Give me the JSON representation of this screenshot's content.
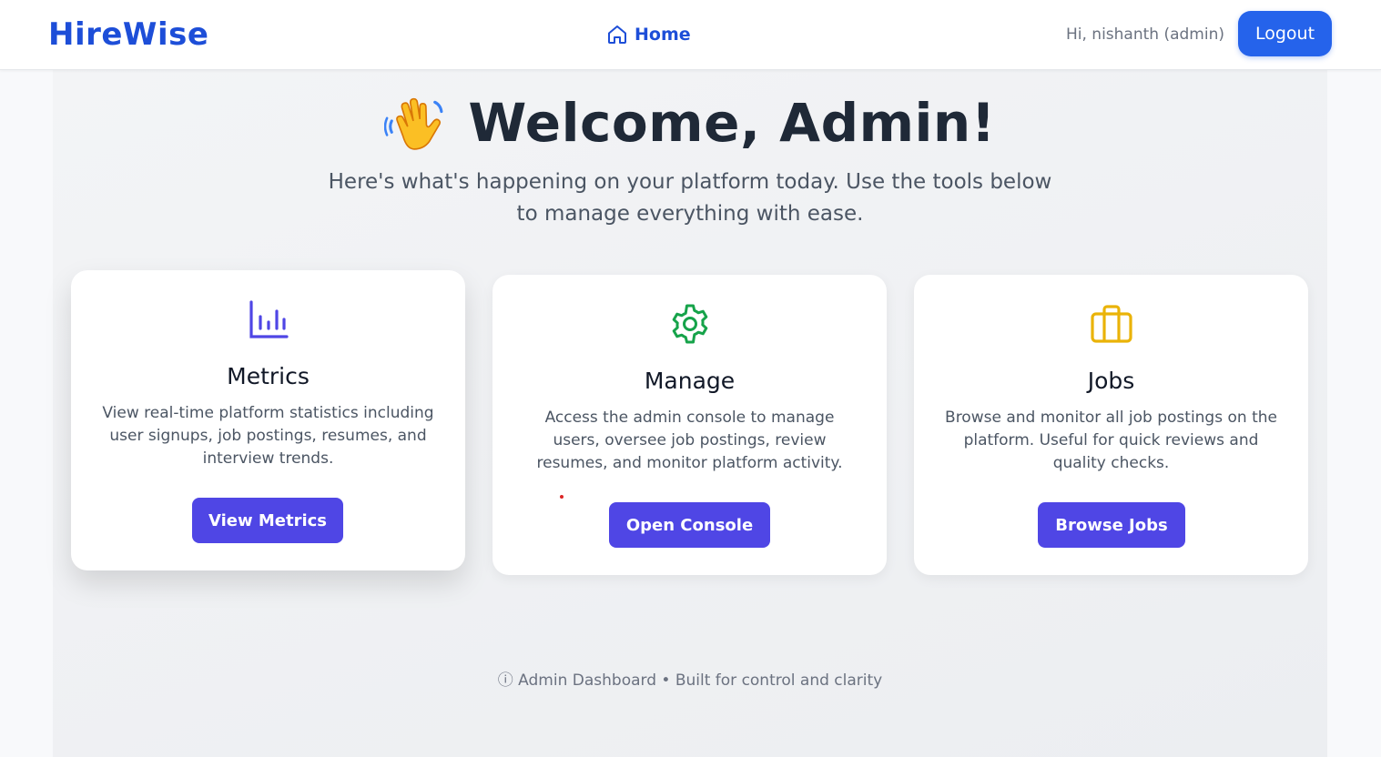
{
  "header": {
    "brand": "HireWise",
    "nav_home": "Home",
    "greeting": "Hi, nishanth (admin)",
    "logout_label": "Logout"
  },
  "hero": {
    "emoji_icon": "waving-hand-icon",
    "title": "Welcome, Admin!",
    "subtitle": "Here's what's happening on your platform today. Use the tools below to manage everything with ease."
  },
  "cards": [
    {
      "icon": "bar-chart-icon",
      "icon_color": "#4f46e5",
      "title": "Metrics",
      "description": "View real-time platform statistics including user signups, job postings, resumes, and interview trends.",
      "button": "View Metrics"
    },
    {
      "icon": "gear-icon",
      "icon_color": "#16a34a",
      "title": "Manage",
      "description": "Access the admin console to manage users, oversee job postings, review resumes, and monitor platform activity.",
      "button": "Open Console"
    },
    {
      "icon": "briefcase-icon",
      "icon_color": "#eab308",
      "title": "Jobs",
      "description": "Browse and monitor all job postings on the platform. Useful for quick reviews and quality checks.",
      "button": "Browse Jobs"
    }
  ],
  "footer": {
    "note": "ⓘ Admin Dashboard • Built for control and clarity"
  },
  "colors": {
    "brand": "#1d4ed8",
    "logout_button": "#2563eb",
    "card_button": "#4f46e5",
    "background": "#f3f4f6"
  }
}
